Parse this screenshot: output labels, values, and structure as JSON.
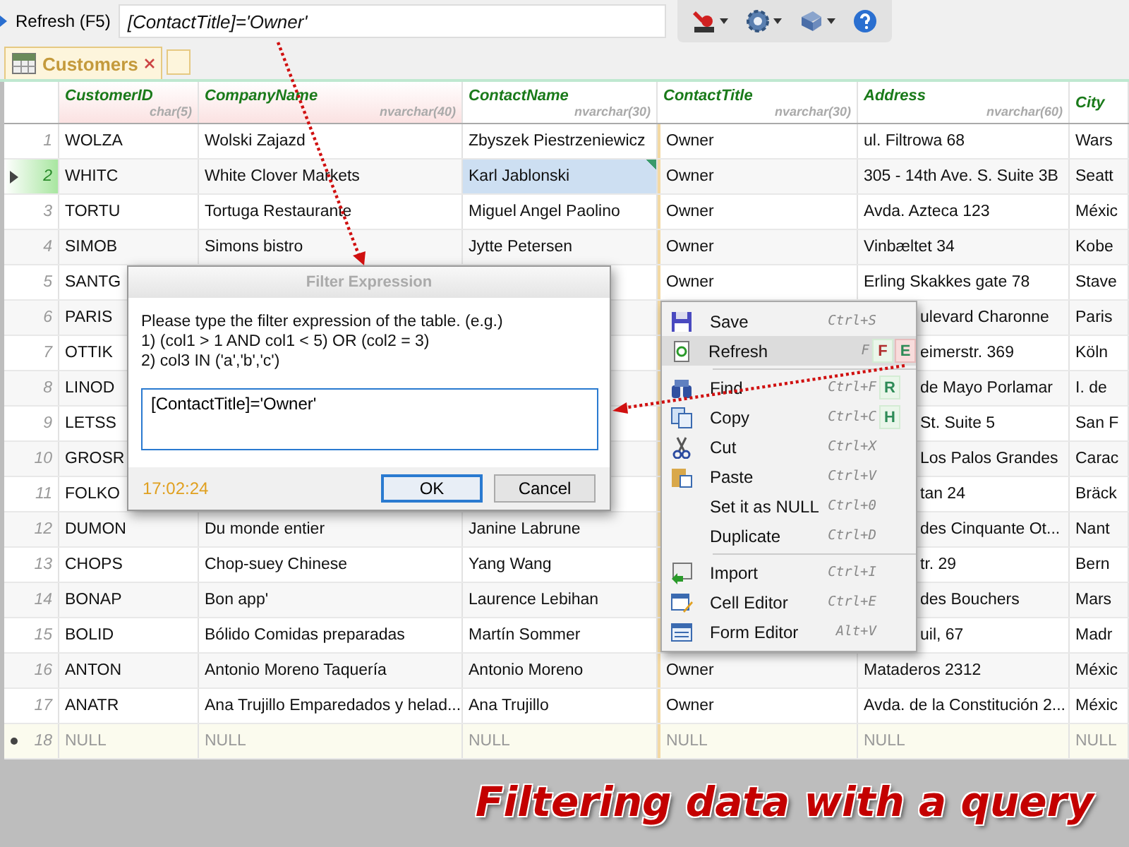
{
  "toolbar": {
    "refresh_button": "Refresh (F5)",
    "filter_value": "[ContactTitle]='Owner'",
    "tools": [
      {
        "kind": "sql",
        "dropdown": true
      },
      {
        "kind": "gear",
        "dropdown": true
      },
      {
        "kind": "book",
        "dropdown": true
      },
      {
        "kind": "help",
        "dropdown": false
      }
    ]
  },
  "tabs": [
    {
      "label": "Customers",
      "selected": true
    }
  ],
  "table": {
    "columns": [
      {
        "name": "CustomerID",
        "type": "char(5)",
        "highlighted": true
      },
      {
        "name": "CompanyName",
        "type": "nvarchar(40)",
        "highlighted": true
      },
      {
        "name": "ContactName",
        "type": "nvarchar(30)",
        "highlighted": false
      },
      {
        "name": "ContactTitle",
        "type": "nvarchar(30)",
        "highlighted": false
      },
      {
        "name": "Address",
        "type": "nvarchar(60)",
        "highlighted": false
      },
      {
        "name": "City",
        "highlighted": false
      }
    ],
    "rows": [
      {
        "number": "1",
        "kind": "data",
        "selected": false,
        "cells": [
          "WOLZA",
          "Wolski Zajazd",
          "Zbyszek Piestrzeniewicz",
          "Owner",
          "ul. Filtrowa 68",
          "Wars"
        ]
      },
      {
        "number": "2",
        "kind": "data",
        "selected": true,
        "cells": [
          "WHITC",
          "White Clover Markets",
          "Karl Jablonski",
          "Owner",
          "305 - 14th Ave. S. Suite 3B",
          "Seatt"
        ]
      },
      {
        "number": "3",
        "kind": "data",
        "selected": false,
        "cells": [
          "TORTU",
          "Tortuga Restaurante",
          "Miguel Angel Paolino",
          "Owner",
          "Avda. Azteca 123",
          "Méxic"
        ]
      },
      {
        "number": "4",
        "kind": "data",
        "selected": false,
        "cells": [
          "SIMOB",
          "Simons bistro",
          "Jytte Petersen",
          "Owner",
          "Vinbæltet 34",
          "Kobe"
        ]
      },
      {
        "number": "5",
        "kind": "data",
        "selected": false,
        "cells": [
          "SANTG",
          null,
          null,
          "Owner",
          "Erling Skakkes gate 78",
          "Stave"
        ]
      },
      {
        "number": "6",
        "kind": "data",
        "selected": false,
        "cells": [
          "PARIS",
          null,
          null,
          null,
          "ulevard Charonne",
          "Paris"
        ]
      },
      {
        "number": "7",
        "kind": "data",
        "selected": false,
        "cells": [
          "OTTIK",
          null,
          null,
          null,
          "eimerstr. 369",
          "Köln"
        ]
      },
      {
        "number": "8",
        "kind": "data",
        "selected": false,
        "cells": [
          "LINOD",
          null,
          null,
          null,
          "de Mayo Porlamar",
          "I. de"
        ]
      },
      {
        "number": "9",
        "kind": "data",
        "selected": false,
        "cells": [
          "LETSS",
          null,
          null,
          null,
          "St. Suite 5",
          "San F"
        ]
      },
      {
        "number": "10",
        "kind": "data",
        "selected": false,
        "cells": [
          "GROSR",
          null,
          null,
          null,
          "Los Palos Grandes",
          "Carac"
        ]
      },
      {
        "number": "11",
        "kind": "data",
        "selected": false,
        "cells": [
          "FOLKO",
          null,
          null,
          null,
          "tan 24",
          "Bräck"
        ]
      },
      {
        "number": "12",
        "kind": "data",
        "selected": false,
        "cells": [
          "DUMON",
          "Du monde entier",
          "Janine Labrune",
          null,
          "des Cinquante Ot...",
          "Nant"
        ]
      },
      {
        "number": "13",
        "kind": "data",
        "selected": false,
        "cells": [
          "CHOPS",
          "Chop-suey Chinese",
          "Yang Wang",
          null,
          "tr. 29",
          "Bern"
        ]
      },
      {
        "number": "14",
        "kind": "data",
        "selected": false,
        "cells": [
          "BONAP",
          "Bon app'",
          "Laurence Lebihan",
          null,
          "des Bouchers",
          "Mars"
        ]
      },
      {
        "number": "15",
        "kind": "data",
        "selected": false,
        "cells": [
          "BOLID",
          "Bólido Comidas preparadas",
          "Martín Sommer",
          null,
          "uil, 67",
          "Madr"
        ]
      },
      {
        "number": "16",
        "kind": "data",
        "selected": false,
        "cells": [
          "ANTON",
          "Antonio Moreno Taquería",
          "Antonio Moreno",
          "Owner",
          "Mataderos  2312",
          "Méxic"
        ]
      },
      {
        "number": "17",
        "kind": "data",
        "selected": false,
        "cells": [
          "ANATR",
          "Ana Trujillo Emparedados y helad...",
          "Ana Trujillo",
          "Owner",
          "Avda. de la Constitución 2...",
          "Méxic"
        ]
      },
      {
        "number": "18",
        "kind": "new",
        "selected": false,
        "cells": [
          "NULL",
          "NULL",
          "NULL",
          "NULL",
          "NULL",
          "NULL"
        ]
      }
    ]
  },
  "dialog": {
    "title": "Filter Expression",
    "message": [
      "Please type the filter expression of the table. (e.g.)",
      "1) (col1 > 1 AND col1 < 5) OR (col2 = 3)",
      "2) col3 IN ('a','b','c')"
    ],
    "value": "[ContactTitle]='Owner'",
    "time": "17:02:24",
    "buttons": [
      {
        "label": "OK",
        "focused": true
      },
      {
        "label": "Cancel",
        "focused": false
      }
    ]
  },
  "context_menu": {
    "items": [
      {
        "kind": "save",
        "label": "Save",
        "shortcut": "Ctrl+S",
        "selected": false
      },
      {
        "kind": "refresh",
        "label": "Refresh",
        "shortcut": "F",
        "selected": true,
        "badges": [
          {
            "label": "F",
            "color": "#b03030",
            "selected": false
          },
          {
            "label": "E",
            "color": "#2e8b57",
            "selected": true
          }
        ]
      },
      {
        "kind": "separator"
      },
      {
        "kind": "find",
        "label": "Find",
        "shortcut": "Ctrl+F",
        "selected": false,
        "badges": [
          {
            "label": "R",
            "color": "#2e8b57",
            "selected": false
          }
        ]
      },
      {
        "kind": "copy",
        "label": "Copy",
        "shortcut": "Ctrl+C",
        "selected": false,
        "badges": [
          {
            "label": "H",
            "color": "#2e8b57",
            "selected": false
          }
        ]
      },
      {
        "kind": "cut",
        "label": "Cut",
        "shortcut": "Ctrl+X",
        "selected": false
      },
      {
        "kind": "paste",
        "label": "Paste",
        "shortcut": "Ctrl+V",
        "selected": false
      },
      {
        "kind": "plain",
        "label": "Set it as NULL",
        "shortcut": "Ctrl+0",
        "selected": false
      },
      {
        "kind": "plain",
        "label": "Duplicate",
        "shortcut": "Ctrl+D",
        "selected": false
      },
      {
        "kind": "separator"
      },
      {
        "kind": "import",
        "label": "Import",
        "shortcut": "Ctrl+I",
        "selected": false
      },
      {
        "kind": "editor",
        "label": "Cell Editor",
        "shortcut": "Ctrl+E",
        "selected": false
      },
      {
        "kind": "form",
        "label": "Form Editor",
        "shortcut": "Alt+V",
        "selected": false
      }
    ]
  },
  "caption": "Filtering data with a query"
}
